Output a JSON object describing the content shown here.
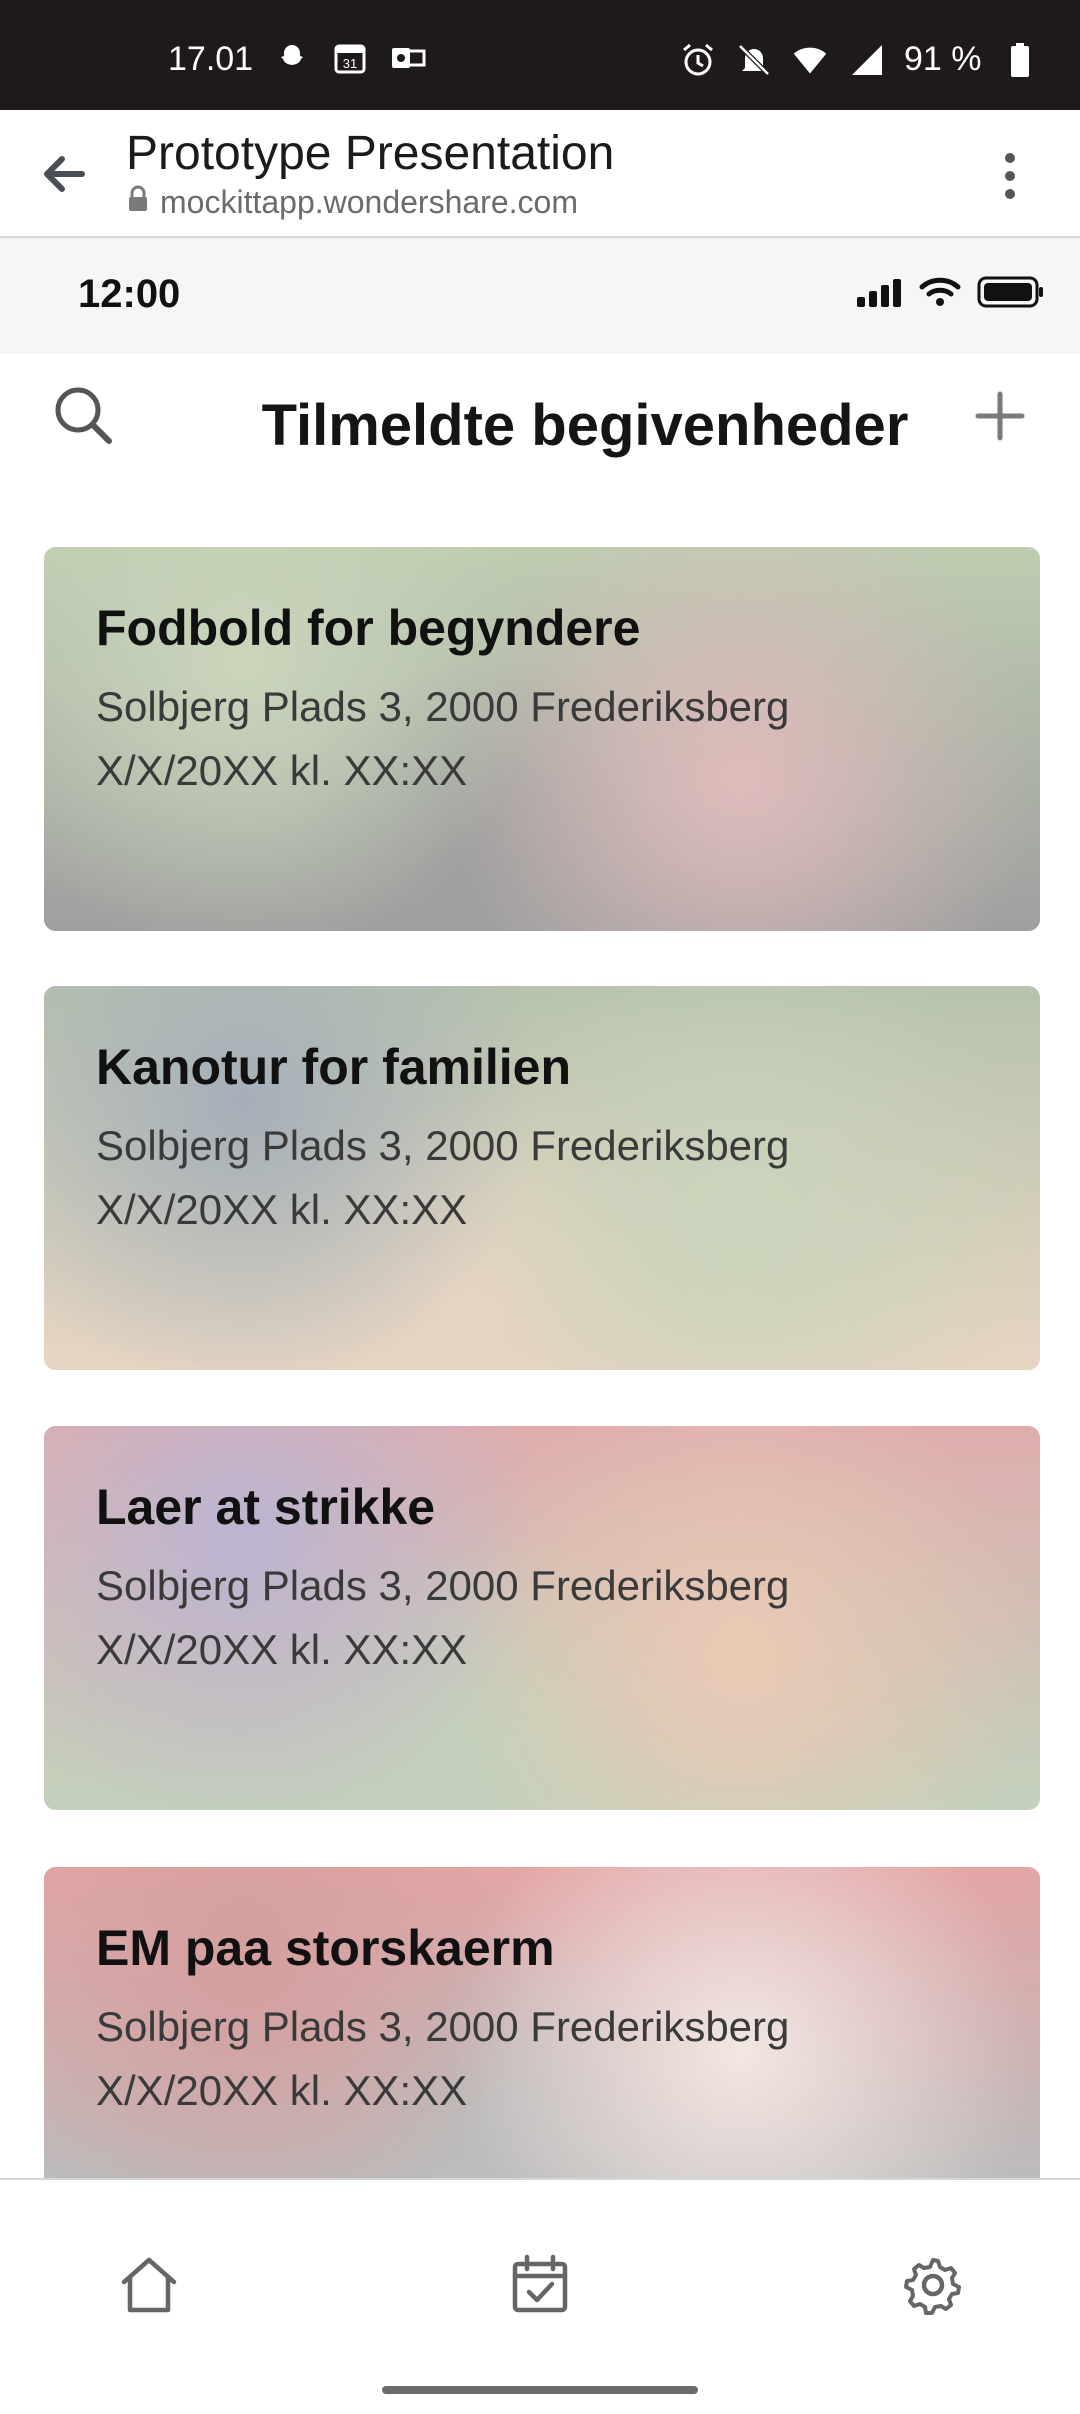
{
  "system_status": {
    "time": "17.01",
    "battery": "91 %",
    "icons_left": [
      "snapchat-icon",
      "calendar-icon",
      "outlook-icon"
    ],
    "icons_right": [
      "alarm-icon",
      "bell-off-icon",
      "wifi-icon",
      "cell-signal-icon",
      "battery-icon"
    ],
    "calendar_badge": "31"
  },
  "browser": {
    "title": "Prototype Presentation",
    "url": "mockittapp.wondershare.com"
  },
  "prototype_status": {
    "time": "12:00"
  },
  "header": {
    "title": "Tilmeldte begivenheder"
  },
  "events": [
    {
      "title": "Fodbold for begyndere",
      "address": "Solbjerg Plads 3, 2000 Frederiksberg",
      "datetime": "X/X/20XX kl. XX:XX",
      "palette": [
        "#6f8f52",
        "#8aa36a",
        "#b86a6a",
        "#2c2c2c"
      ]
    },
    {
      "title": "Kanotur for familien",
      "address": "Solbjerg Plads 3, 2000 Frederiksberg",
      "datetime": "X/X/20XX kl. XX:XX",
      "palette": [
        "#5e7a4a",
        "#3a4f66",
        "#8aa06a",
        "#c9a27a"
      ]
    },
    {
      "title": "Laer at strikke",
      "address": "Solbjerg Plads 3, 2000 Frederiksberg",
      "datetime": "X/X/20XX kl. XX:XX",
      "palette": [
        "#b84a4a",
        "#6a5a9a",
        "#d08a5a",
        "#7a9a6a"
      ]
    },
    {
      "title": "EM paa storskaerm",
      "address": "Solbjerg Plads 3, 2000 Frederiksberg",
      "datetime": "X/X/20XX kl. XX:XX",
      "palette": [
        "#c43a3a",
        "#a02a2a",
        "#e2c9c0",
        "#6a6a6a"
      ]
    }
  ],
  "bottom_nav": [
    "home-icon",
    "calendar-check-icon",
    "gear-icon"
  ]
}
